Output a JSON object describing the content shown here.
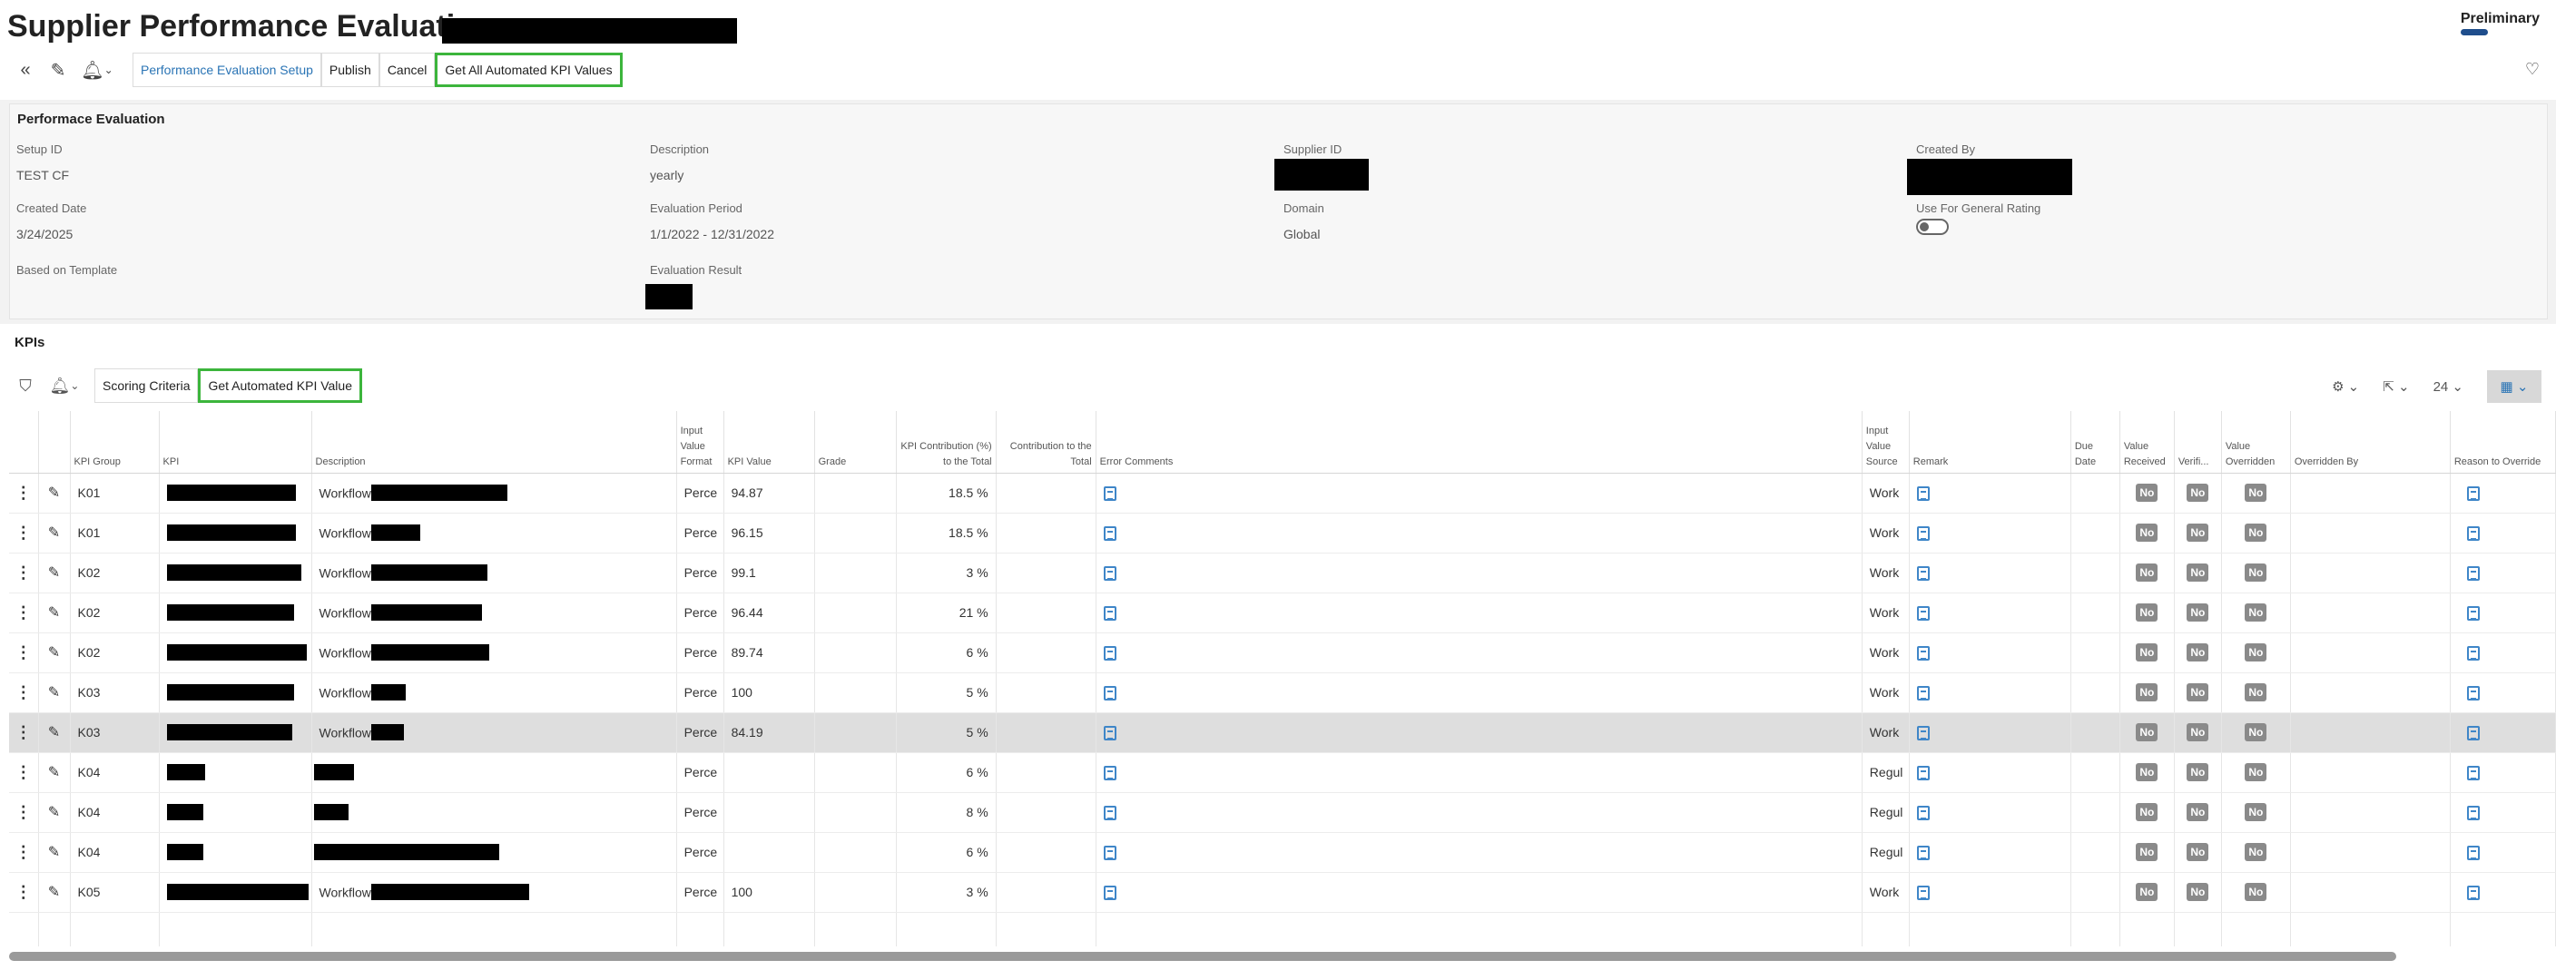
{
  "page": {
    "title": "Supplier Performance Evaluation",
    "status": "Preliminary"
  },
  "toolbar": {
    "setup_label": "Performance Evaluation Setup",
    "publish_label": "Publish",
    "cancel_label": "Cancel",
    "get_all_label": "Get All Automated KPI Values"
  },
  "eval": {
    "title": "Performace Evaluation",
    "fields": {
      "setup_id": {
        "label": "Setup ID",
        "value": "TEST CF"
      },
      "description": {
        "label": "Description",
        "value": "yearly"
      },
      "supplier_id": {
        "label": "Supplier ID",
        "value": ""
      },
      "created_by": {
        "label": "Created By",
        "value": ""
      },
      "created_date": {
        "label": "Created Date",
        "value": "3/24/2025"
      },
      "evaluation_period": {
        "label": "Evaluation Period",
        "value": "1/1/2022 - 12/31/2022"
      },
      "domain": {
        "label": "Domain",
        "value": "Global"
      },
      "use_general": {
        "label": "Use For General Rating",
        "value": false
      },
      "based_on_template": {
        "label": "Based on Template",
        "value": ""
      },
      "evaluation_result": {
        "label": "Evaluation Result",
        "value": ""
      }
    }
  },
  "kpis": {
    "title": "KPIs",
    "scoring_label": "Scoring Criteria",
    "get_kpi_label": "Get Automated KPI Value",
    "page_size": "24",
    "columns": {
      "kpi_group": "KPI Group",
      "kpi": "KPI",
      "description": "Description",
      "input_format": "Input Value Format",
      "kpi_value": "KPI Value",
      "grade": "Grade",
      "contribution_pct": "KPI Contribution (%) to the Total",
      "contribution_total": "Contribution to the Total",
      "error_comments": "Error Comments",
      "input_source": "Input Value Source",
      "remark": "Remark",
      "due_date": "Due Date",
      "value_received": "Value Received",
      "verified": "Verifi...",
      "value_overridden": "Value Overridden",
      "overridden_by": "Overridden By",
      "reason_override": "Reason to Override"
    },
    "rows": [
      {
        "group": "K01",
        "desc": "Workflow",
        "format": "Perce",
        "value": "94.87",
        "contrib": "18.5 %",
        "source": "Work",
        "received": "No",
        "verified": "No",
        "overridden": "No"
      },
      {
        "group": "K01",
        "desc": "Workflow",
        "format": "Perce",
        "value": "96.15",
        "contrib": "18.5 %",
        "source": "Work",
        "received": "No",
        "verified": "No",
        "overridden": "No"
      },
      {
        "group": "K02",
        "desc": "Workflow",
        "format": "Perce",
        "value": "99.1",
        "contrib": "3 %",
        "source": "Work",
        "received": "No",
        "verified": "No",
        "overridden": "No"
      },
      {
        "group": "K02",
        "desc": "Workflow",
        "format": "Perce",
        "value": "96.44",
        "contrib": "21 %",
        "source": "Work",
        "received": "No",
        "verified": "No",
        "overridden": "No"
      },
      {
        "group": "K02",
        "desc": "Workflow",
        "format": "Perce",
        "value": "89.74",
        "contrib": "6 %",
        "source": "Work",
        "received": "No",
        "verified": "No",
        "overridden": "No"
      },
      {
        "group": "K03",
        "desc": "Workflow",
        "format": "Perce",
        "value": "100",
        "contrib": "5 %",
        "source": "Work",
        "received": "No",
        "verified": "No",
        "overridden": "No"
      },
      {
        "group": "K03",
        "desc": "Workflow",
        "format": "Perce",
        "value": "84.19",
        "contrib": "5 %",
        "source": "Work",
        "received": "No",
        "verified": "No",
        "overridden": "No"
      },
      {
        "group": "K04",
        "desc": "",
        "format": "Perce",
        "value": "",
        "contrib": "6 %",
        "source": "Regul",
        "received": "No",
        "verified": "No",
        "overridden": "No"
      },
      {
        "group": "K04",
        "desc": "",
        "format": "Perce",
        "value": "",
        "contrib": "8 %",
        "source": "Regul",
        "received": "No",
        "verified": "No",
        "overridden": "No"
      },
      {
        "group": "K04",
        "desc": "",
        "format": "Perce",
        "value": "",
        "contrib": "6 %",
        "source": "Regul",
        "received": "No",
        "verified": "No",
        "overridden": "No"
      },
      {
        "group": "K05",
        "desc": "Workflow",
        "format": "Perce",
        "value": "100",
        "contrib": "3 %",
        "source": "Work",
        "received": "No",
        "verified": "No",
        "overridden": "No"
      }
    ]
  },
  "icons": {
    "back": "double-chevron-left-icon",
    "edit": "pencil-icon",
    "notify": "bell-icon",
    "favorite": "heart-icon",
    "filter": "funnel-icon",
    "settings": "gear-icon",
    "export": "export-icon",
    "view": "table-view-icon"
  },
  "colors": {
    "accent": "#2a74b5",
    "highlight": "#3cb53c",
    "status": "#1f4e8c"
  }
}
